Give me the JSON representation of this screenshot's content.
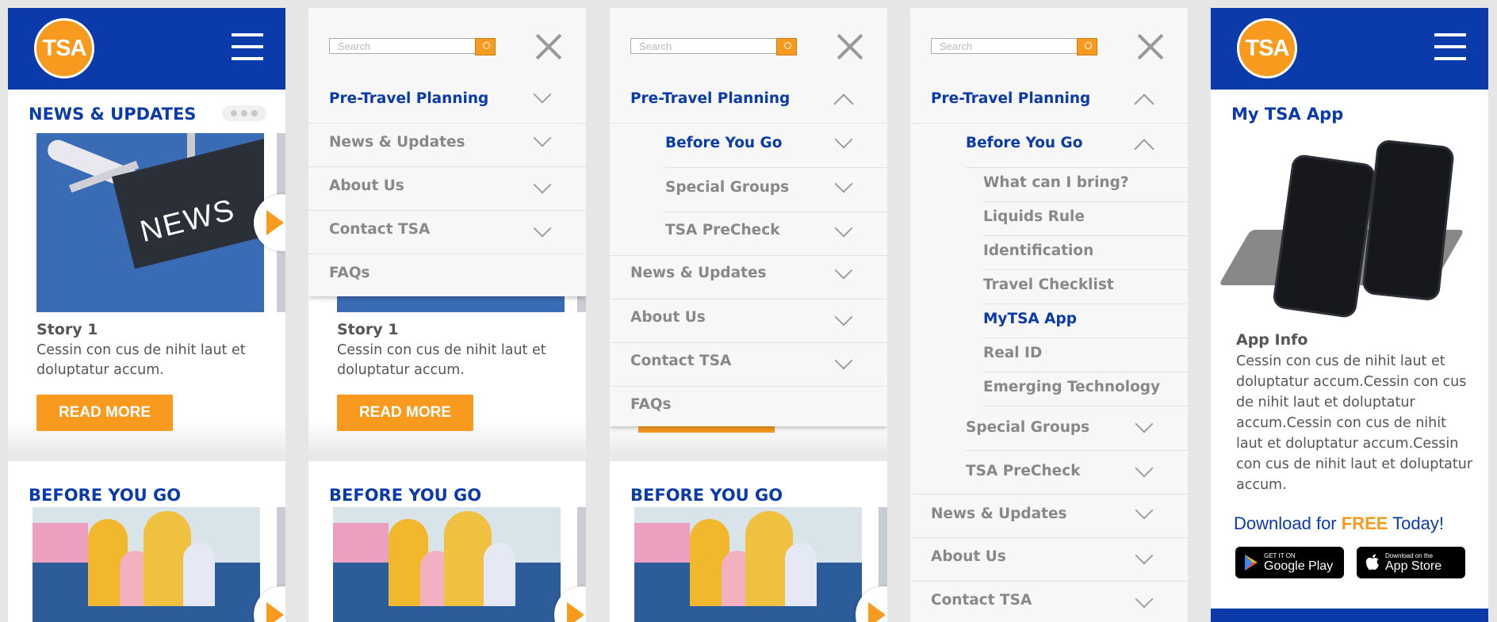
{
  "brand": {
    "logo_text": "TSA",
    "blue": "#0b3aab",
    "orange": "#f79a1e"
  },
  "news": {
    "section_title": "NEWS & UPDATES",
    "image_sign_text": "NEWS",
    "story_title": "Story 1",
    "story_text": "Cessin con cus de nihit laut et doluptatur accum.",
    "read_more": "READ MORE"
  },
  "before_you_go": {
    "section_title": "BEFORE YOU GO"
  },
  "search": {
    "placeholder": "Search"
  },
  "menu": {
    "pre_travel": "Pre-Travel Planning",
    "news_updates": "News & Updates",
    "about_us": "About Us",
    "contact": "Contact TSA",
    "faqs": "FAQs",
    "before_you_go": "Before You Go",
    "special_groups": "Special Groups",
    "precheck": "TSA PreCheck",
    "sub_items": [
      "What can I bring?",
      "Liquids Rule",
      "Identification",
      "Travel Checklist",
      "MyTSA App",
      "Real ID",
      "Emerging Technology"
    ]
  },
  "app_page": {
    "title": "My TSA App",
    "info_title": "App Info",
    "info_text": "Cessin con cus de nihit laut et doluptatur accum.Cessin con cus de nihit laut et doluptatur accum.Cessin con cus de nihit laut et doluptatur accum.Cessin con cus de nihit laut et doluptatur accum.",
    "download_prefix": "Download for ",
    "download_free": "FREE",
    "download_suffix": " Today!",
    "google_small": "GET IT ON",
    "google_big": "Google Play",
    "apple_small": "Download on the",
    "apple_big": "App Store"
  }
}
